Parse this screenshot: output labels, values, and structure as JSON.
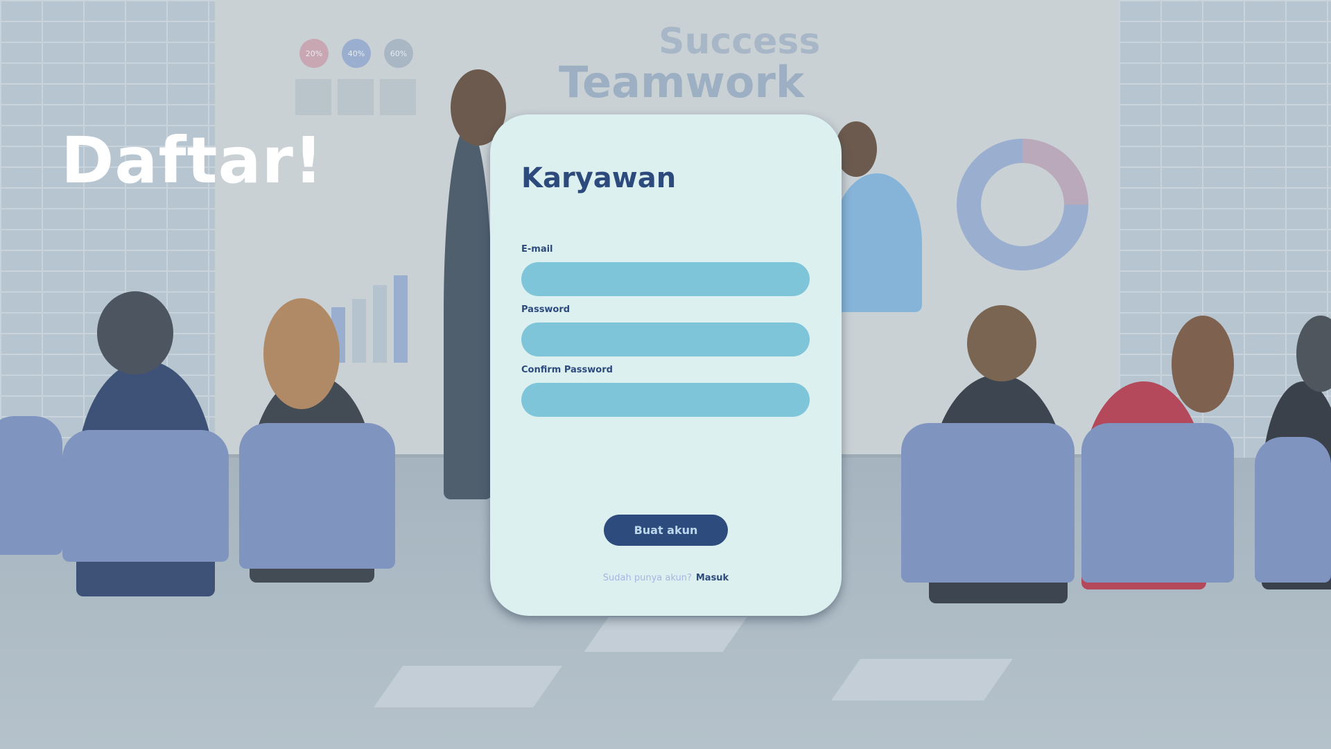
{
  "hero": {
    "title": "Daftar!"
  },
  "background": {
    "screen_words": [
      "Success",
      "Teamwork"
    ],
    "bubbles": [
      "20%",
      "40%",
      "60%"
    ]
  },
  "form": {
    "title": "Karyawan",
    "fields": [
      {
        "label": "E-mail",
        "value": "",
        "placeholder": ""
      },
      {
        "label": "Password",
        "value": "",
        "placeholder": ""
      },
      {
        "label": "Confirm Password",
        "value": "",
        "placeholder": ""
      }
    ],
    "submit_label": "Buat akun",
    "footer": {
      "question": "Sudah punya akun?",
      "link_label": "Masuk"
    }
  },
  "colors": {
    "card_background": "#dcf0f0",
    "input_fill": "#7fc5da",
    "primary": "#2e4b7d",
    "title_text": "#2d4a7c",
    "hero_text": "#ffffff",
    "muted_text": "#a6b6e2"
  }
}
